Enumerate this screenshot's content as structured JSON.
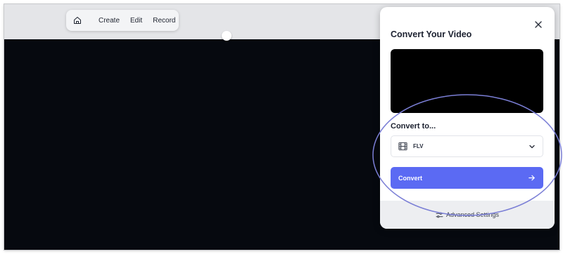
{
  "toolbar": {
    "home_icon": "home-icon",
    "items": [
      {
        "label": "Create"
      },
      {
        "label": "Edit"
      },
      {
        "label": "Record"
      }
    ]
  },
  "panel": {
    "title": "Convert Your Video",
    "close_icon": "close-icon",
    "convert_to_label": "Convert to...",
    "format": {
      "icon": "film-icon",
      "selected": "FLV",
      "dropdown_icon": "chevron-down-icon"
    },
    "convert_button": {
      "label": "Convert",
      "icon": "arrow-right-icon",
      "color": "#5b6af3"
    },
    "advanced_settings": {
      "label": "Advanced Settings",
      "icon": "sliders-icon"
    }
  },
  "colors": {
    "video_background": "#06090f",
    "highlight_ellipse": "#7b7fd6"
  }
}
